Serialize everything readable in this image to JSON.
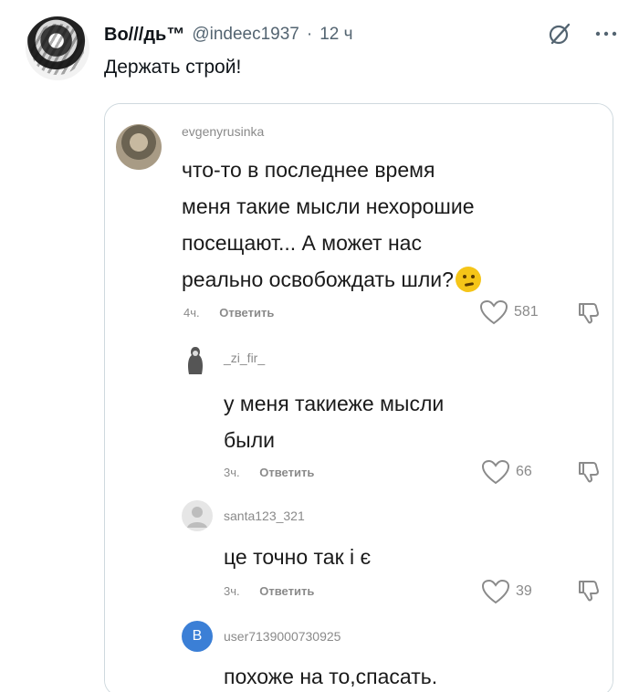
{
  "tweet": {
    "display_name": "Во///дь™",
    "handle": "@indeec1937",
    "separator": "·",
    "time": "12 ч",
    "text": "Держать строй!"
  },
  "comments": [
    {
      "user": "evgenyrusinka",
      "text_lines": [
        "что-то в последнее время",
        "меня такие мысли нехорошие",
        "посещают... А может нас",
        "реально освобождать шли?"
      ],
      "time": "4ч.",
      "reply_label": "Ответить",
      "likes": "581"
    },
    {
      "user": "_zi_fir_",
      "text_lines": [
        "у меня такиеже мысли",
        "были"
      ],
      "time": "3ч.",
      "reply_label": "Ответить",
      "likes": "66"
    },
    {
      "user": "santa123_321",
      "text_lines": [
        "це точно так і є"
      ],
      "time": "3ч.",
      "reply_label": "Ответить",
      "likes": "39"
    },
    {
      "user": "user7139000730925",
      "avatar_letter": "B",
      "text_lines": [
        "похоже на то,спасать."
      ]
    }
  ],
  "icons": {
    "grok": "grok-icon",
    "more": "more-icon",
    "like": "heart-outline-icon",
    "dislike": "thumbs-down-icon"
  },
  "colors": {
    "text": "#0f1419",
    "secondary": "#536471",
    "comment_meta": "#8a8a8a",
    "avatar_b": "#3b7fd6"
  }
}
